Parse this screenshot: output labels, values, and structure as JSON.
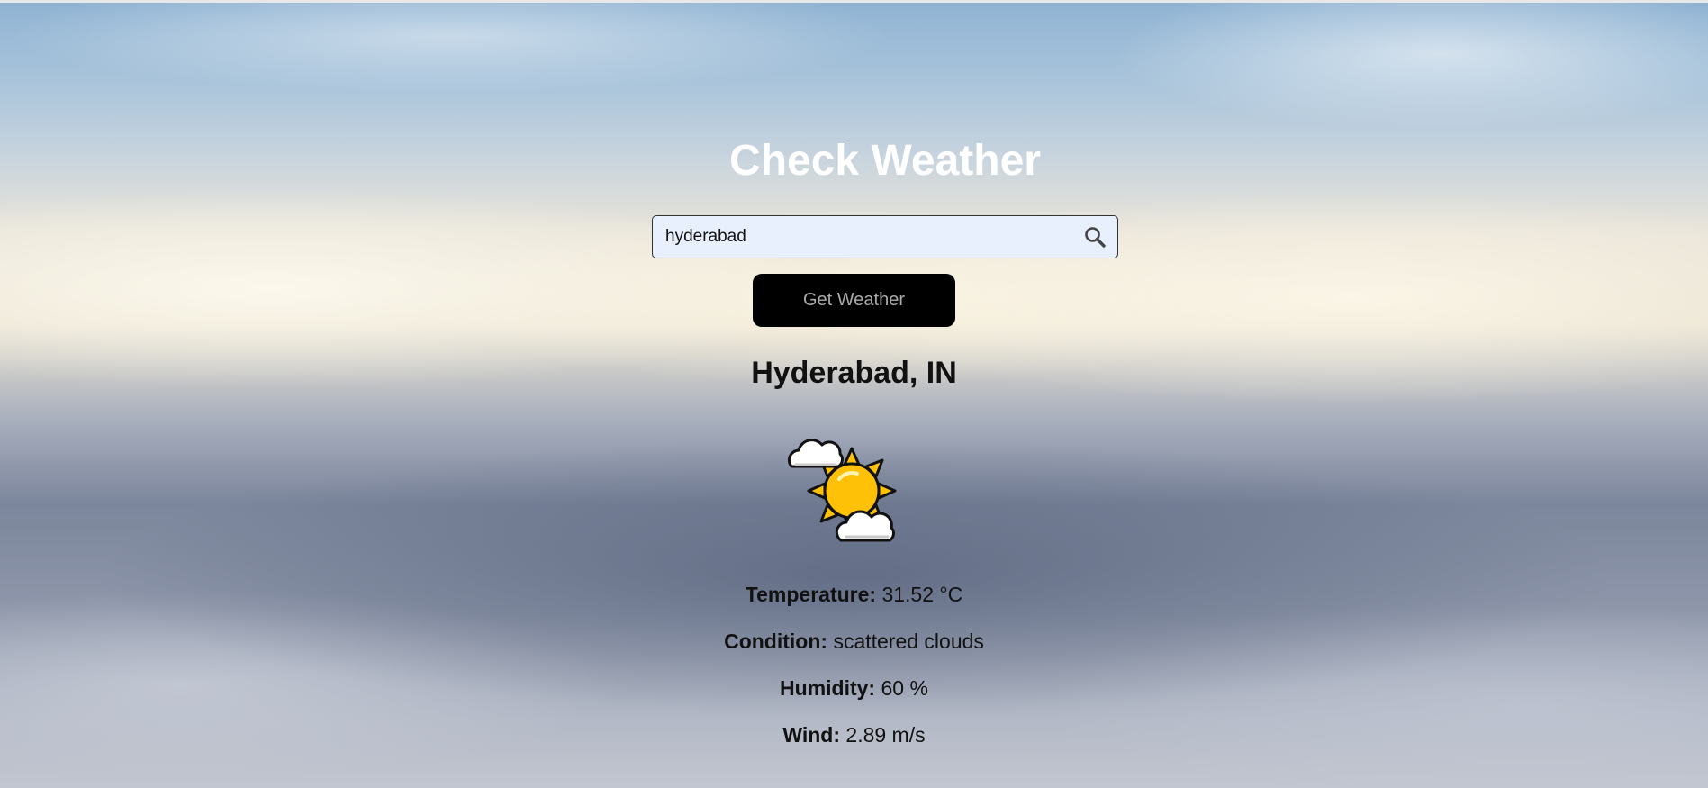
{
  "app": {
    "title": "Check Weather"
  },
  "search": {
    "value": "hyderabad",
    "icon": "search-icon"
  },
  "action": {
    "get_weather_label": "Get Weather"
  },
  "result": {
    "location": "Hyderabad, IN",
    "icon": "partly-cloudy-sun-icon",
    "temperature_label": "Temperature:",
    "temperature_value": "31.52 °C",
    "condition_label": "Condition:",
    "condition_value": "scattered clouds",
    "humidity_label": "Humidity:",
    "humidity_value": "60 %",
    "wind_label": "Wind:",
    "wind_value": "2.89 m/s"
  },
  "colors": {
    "title_text": "#ffffff",
    "input_background": "#e8f0fe",
    "button_background": "#000000",
    "button_text": "#aaaaaa",
    "sun": "#ffc107"
  }
}
